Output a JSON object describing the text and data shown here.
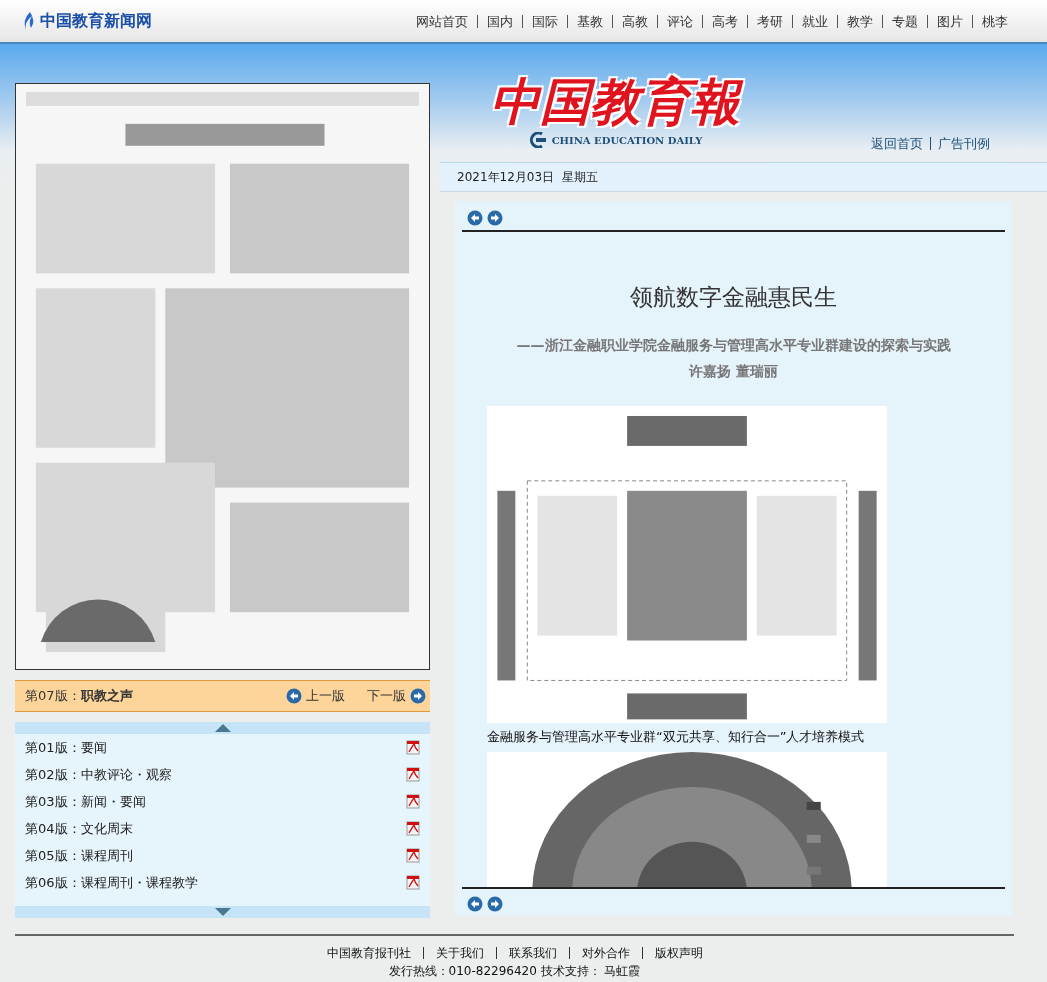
{
  "top_nav": {
    "site_name": "中国教育新闻网",
    "links": [
      "网站首页",
      "国内",
      "国际",
      "基教",
      "高教",
      "评论",
      "高考",
      "考研",
      "就业",
      "教学",
      "专题",
      "图片",
      "桃李"
    ]
  },
  "masthead": {
    "logo_title": "中国教育報",
    "logo_subtitle": "CHINA EDUCATION DAILY",
    "links": [
      "返回首页",
      "广告刊例"
    ]
  },
  "date": "2021年12月03日  星期五",
  "page_scan": {
    "kind": "picture"
  },
  "edition_bar": {
    "label": "第07版：",
    "name": "职教之声",
    "prev": "上一版",
    "next": "下一版"
  },
  "editions": [
    {
      "label": "第01版：要闻"
    },
    {
      "label": "第02版：中教评论・观察"
    },
    {
      "label": "第03版：新闻・要闻"
    },
    {
      "label": "第04版：文化周末"
    },
    {
      "label": "第05版：课程周刊"
    },
    {
      "label": "第06版：课程周刊・课程教学"
    }
  ],
  "article": {
    "title": "领航数字金融惠民生",
    "subtitle": "——浙江金融职业学院金融服务与管理高水平专业群建设的探索与实践",
    "authors": "许嘉扬  董瑞丽",
    "figures": [
      {
        "kind": "picture",
        "caption": "金融服务与管理高水平专业群“双元共享、知行合一”人才培养模式"
      },
      {
        "kind": "picture"
      }
    ]
  },
  "footer": {
    "links": [
      "中国教育报刊社",
      "关于我们",
      "联系我们",
      "对外合作",
      "版权声明"
    ],
    "hotline": "发行热线：010-82296420 技术支持： 马虹霞"
  }
}
